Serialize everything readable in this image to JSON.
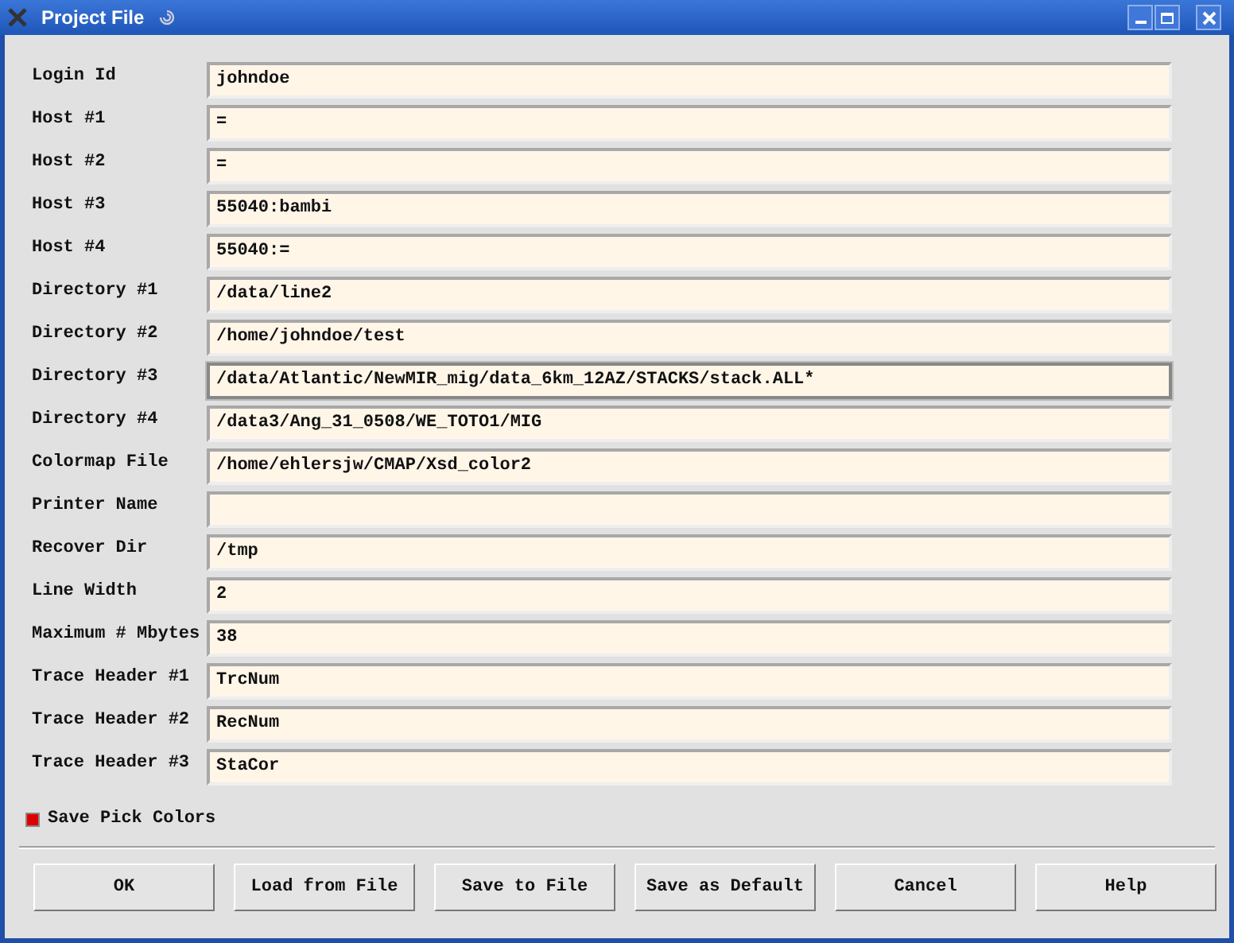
{
  "window": {
    "title": "Project File"
  },
  "fields": [
    {
      "label": "Login Id",
      "value": "johndoe",
      "focused": false
    },
    {
      "label": "Host #1",
      "value": "=",
      "focused": false
    },
    {
      "label": "Host #2",
      "value": "=",
      "focused": false
    },
    {
      "label": "Host #3",
      "value": "55040:bambi",
      "focused": false
    },
    {
      "label": "Host #4",
      "value": "55040:=",
      "focused": false
    },
    {
      "label": "Directory #1",
      "value": "/data/line2",
      "focused": false
    },
    {
      "label": "Directory #2",
      "value": "/home/johndoe/test",
      "focused": false
    },
    {
      "label": "Directory #3",
      "value": "/data/Atlantic/NewMIR_mig/data_6km_12AZ/STACKS/stack.ALL*",
      "focused": true
    },
    {
      "label": "Directory #4",
      "value": "/data3/Ang_31_0508/WE_TOTO1/MIG",
      "focused": false
    },
    {
      "label": "Colormap File",
      "value": "/home/ehlersjw/CMAP/Xsd_color2",
      "focused": false
    },
    {
      "label": "Printer Name",
      "focused": false
    },
    {
      "label": "Recover Dir",
      "value": "/tmp",
      "focused": false
    },
    {
      "label": "Line Width",
      "value": "2",
      "focused": false
    },
    {
      "label": "Maximum # Mbytes",
      "value": "38",
      "focused": false
    },
    {
      "label": "Trace Header #1",
      "value": "TrcNum",
      "focused": false
    },
    {
      "label": "Trace Header #2",
      "value": "RecNum",
      "focused": false
    },
    {
      "label": "Trace Header #3",
      "value": "StaCor",
      "focused": false
    }
  ],
  "toggle": {
    "label": "Save Pick Colors",
    "checked": true
  },
  "buttons": [
    "OK",
    "Load from File",
    "Save to File",
    "Save as Default",
    "Cancel",
    "Help"
  ]
}
